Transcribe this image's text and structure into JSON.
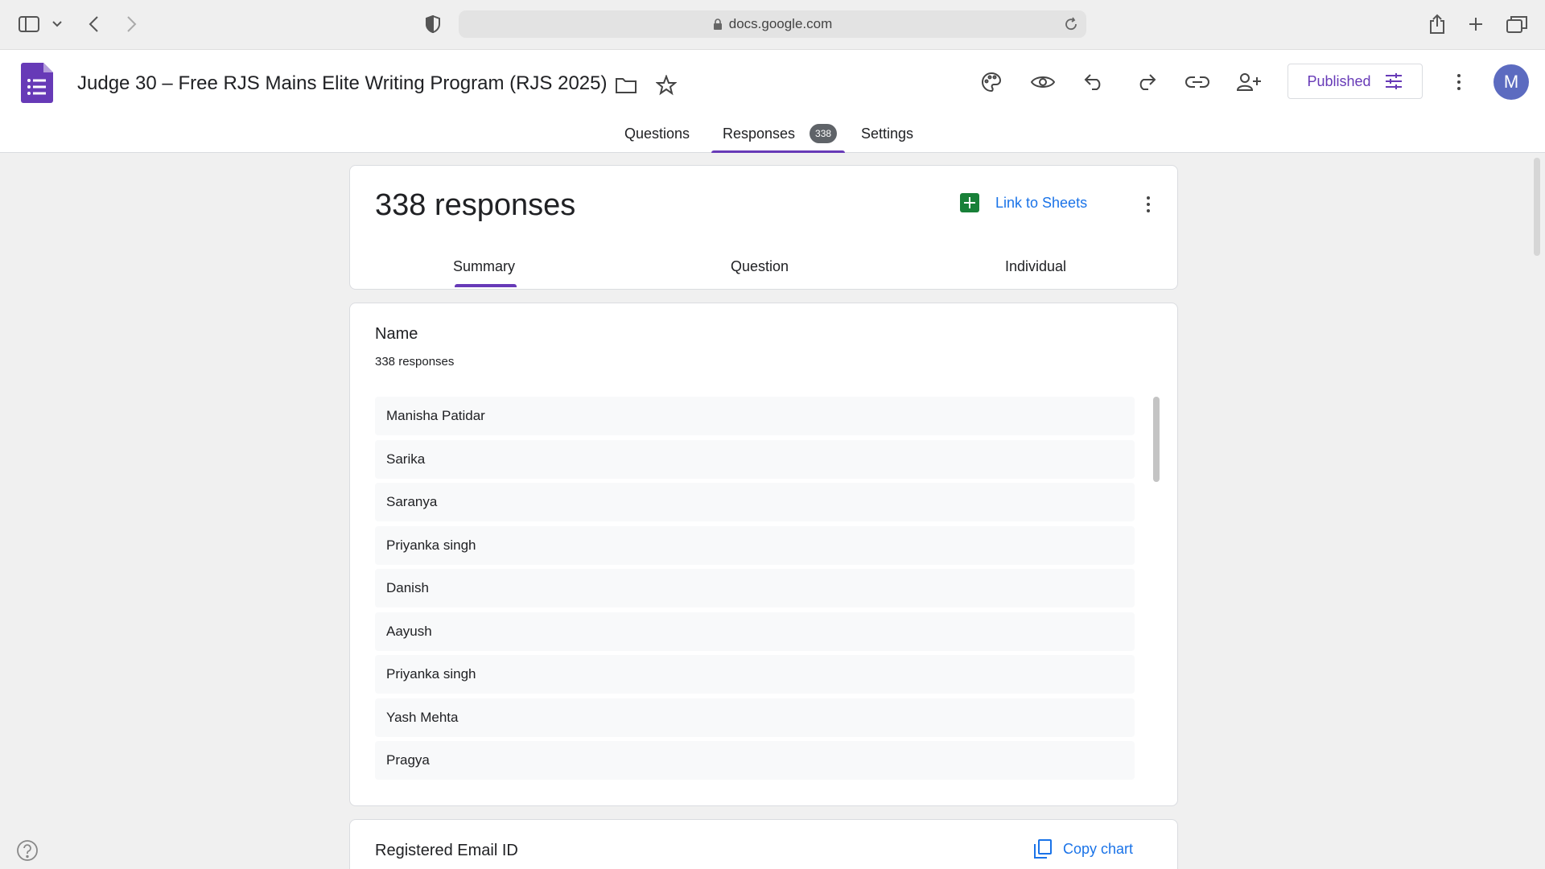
{
  "browser": {
    "url": "docs.google.com"
  },
  "header": {
    "title": "Judge 30 – Free RJS Mains Elite Writing Program (RJS 2025)",
    "published_label": "Published",
    "avatar_initial": "M",
    "tabs": [
      {
        "label": "Questions"
      },
      {
        "label": "Responses",
        "badge": "338"
      },
      {
        "label": "Settings"
      }
    ]
  },
  "responses": {
    "title": "338 responses",
    "link_sheets_label": "Link to Sheets",
    "sub_tabs": [
      "Summary",
      "Question",
      "Individual"
    ]
  },
  "name_question": {
    "title": "Name",
    "count": "338 responses",
    "items": [
      "Manisha Patidar",
      "Sarika",
      "Saranya",
      "Priyanka singh",
      "Danish",
      "Aayush",
      "Priyanka singh",
      "Yash Mehta",
      "Pragya"
    ]
  },
  "email_question": {
    "title": "Registered Email ID",
    "copy_chart_label": "Copy chart"
  },
  "colors": {
    "accent": "#673ab7",
    "link": "#1a73e8",
    "sheets_green": "#188038",
    "avatar": "#5c6bc0"
  },
  "icons": {
    "browser": [
      "sidebar-icon",
      "chevron-down-icon",
      "back-icon",
      "forward-icon",
      "shield-icon",
      "lock-icon",
      "reload-icon",
      "share-icon",
      "plus-icon",
      "tabs-icon"
    ],
    "toolbar": [
      "palette-icon",
      "eye-icon",
      "undo-icon",
      "redo-icon",
      "link-icon",
      "add-person-icon",
      "sliders-icon",
      "more-vert-icon"
    ]
  }
}
